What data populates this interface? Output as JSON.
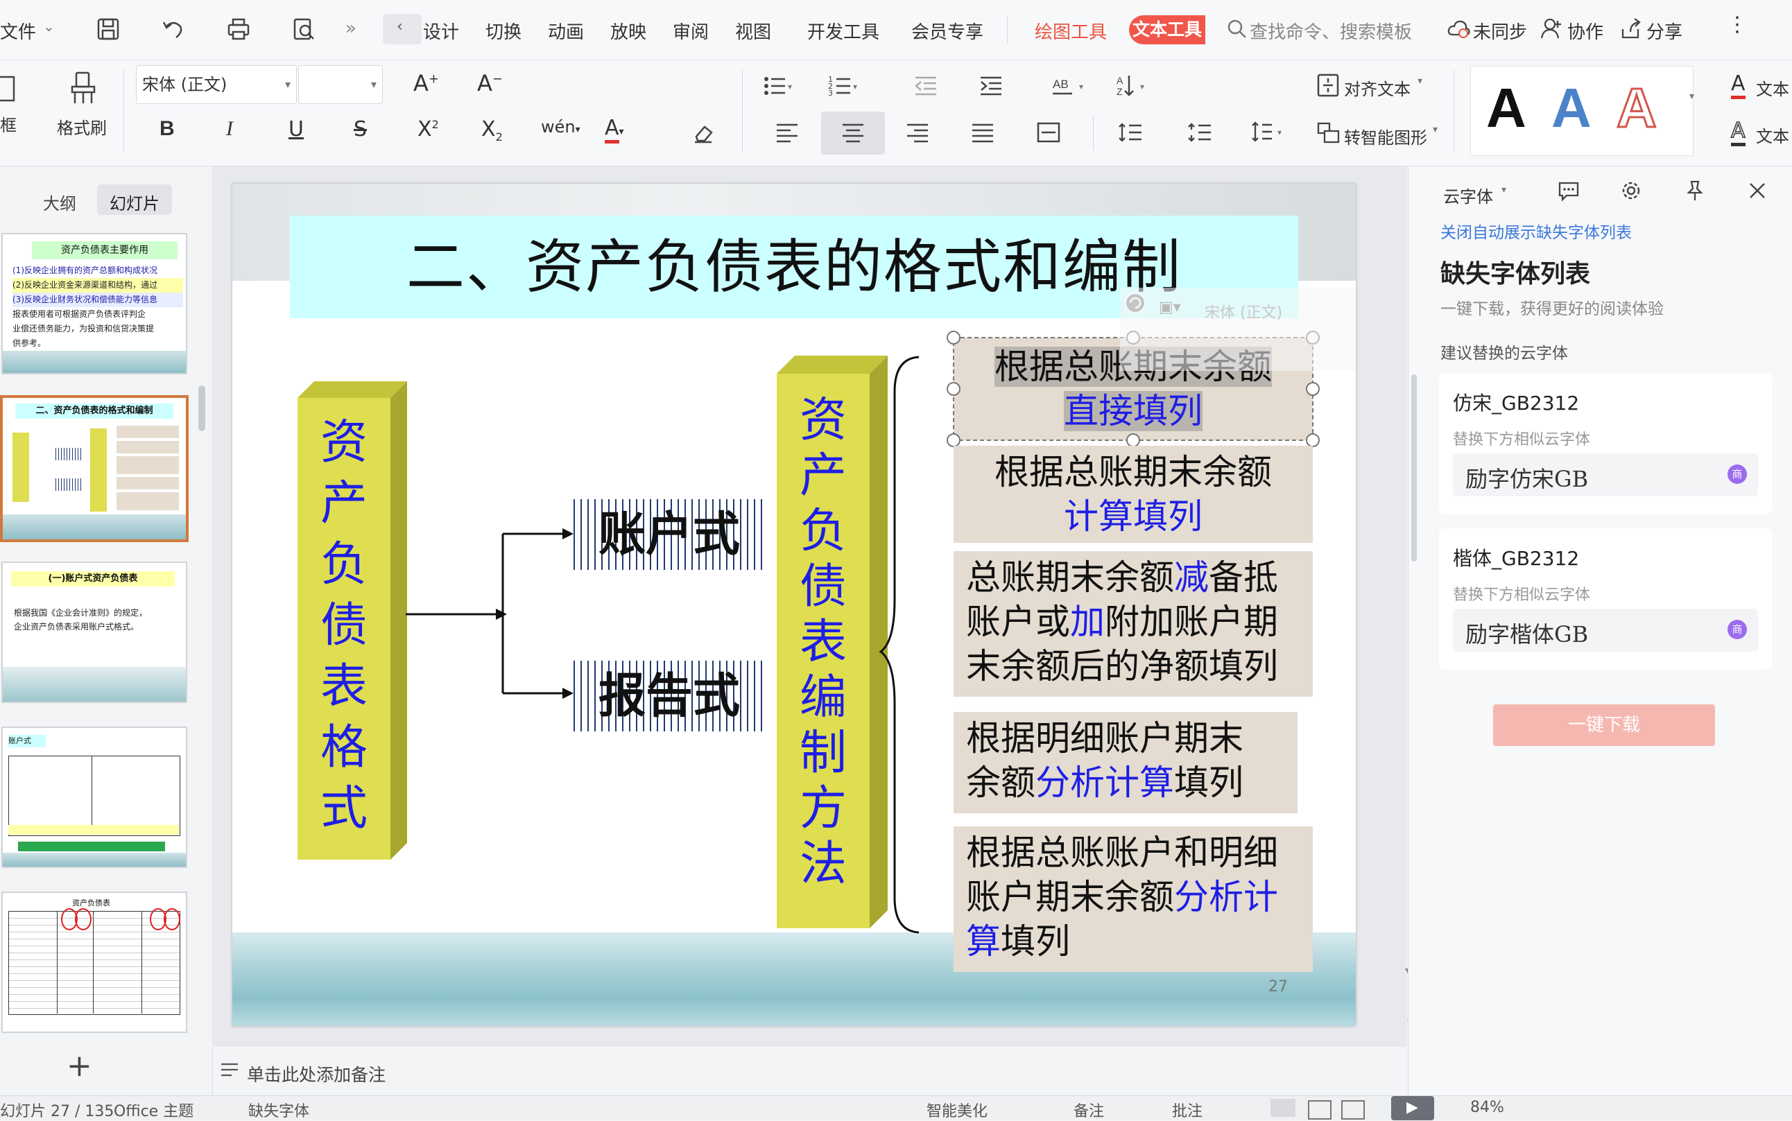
{
  "menubar": {
    "file": "文件",
    "tabs": [
      "设计",
      "切换",
      "动画",
      "放映",
      "审阅",
      "视图",
      "开发工具",
      "会员专享"
    ],
    "drawing_tools": "绘图工具",
    "text_tools": "文本工具",
    "search_placeholder": "查找命令、搜索模板",
    "sync": "未同步",
    "collab": "协作",
    "share": "分享"
  },
  "ribbon": {
    "textbox_label": "框",
    "format_painter": "格式刷",
    "font_name": "宋体 (正文)",
    "font_size": "",
    "align_text": "对齐文本",
    "smart_shape": "转智能图形",
    "text_fill": "文本",
    "text_outline": "文本",
    "style_letter": "A"
  },
  "leftpane": {
    "tab_outline": "大纲",
    "tab_slides": "幻灯片",
    "thumb1": {
      "title": "资产负债表主要作用",
      "lines": [
        "(1)反映企业拥有的资产总额和构成状况",
        "(2)反映企业资金来源渠道和结构，通过",
        "(3)反映企业财务状况和偿债能力等信息",
        "报表使用者可根据资产负债表评判企",
        "业偿还债务能力，为投资和信贷决策提",
        "供参考。"
      ]
    },
    "thumb2": {
      "title": "二、资产负债表的格式和编制"
    },
    "thumb3": {
      "title": "(一)账户式资产负债表",
      "lines": [
        "根据我国《企业会计准则》的规定，",
        "企业资产负债表采用账户式格式。"
      ]
    },
    "thumb4": {
      "title": "账户式"
    },
    "thumb5": {
      "title": "资产负债表"
    },
    "add": "+"
  },
  "slide": {
    "title": "二、资产负债表的格式和编制",
    "left_column": "资产负债表格式",
    "mid_column": "资产负债表编制方法",
    "account_form": "账户式",
    "report_form": "报告式",
    "page_number": "27",
    "methods": [
      {
        "line1": "根据总账期末余额",
        "line2": "直接填列"
      },
      {
        "line1": "根据总账期末余额",
        "line2": "计算填列"
      },
      {
        "a": "总账期末余额",
        "b": "减",
        "c": "备抵",
        "d": "账户或",
        "e": "加",
        "f": "附加账户期",
        "g": "末余额后的净额填列"
      },
      {
        "a": "根据明细账户期末",
        "b": "余额",
        "c": "分析计算",
        "d": "填列"
      },
      {
        "a": "根据总账账户和明细",
        "b": "账户期末余额",
        "c": "分析计",
        "d": "算",
        "e": "填列"
      }
    ],
    "mini_toolbar_font": "宋体 (正文)"
  },
  "rightpane": {
    "cloud_font": "云字体",
    "close_auto": "关闭自动展示缺失字体列表",
    "heading": "缺失字体列表",
    "subheading": "一键下载，获得更好的阅读体验",
    "suggest": "建议替换的云字体",
    "fonts": [
      {
        "name": "仿宋_GB2312",
        "hint": "替换下方相似云字体",
        "replacement": "励字仿宋GB",
        "badge": "商"
      },
      {
        "name": "楷体_GB2312",
        "hint": "替换下方相似云字体",
        "replacement": "励字楷体GB",
        "badge": "商"
      }
    ],
    "download": "一键下载"
  },
  "notes": {
    "placeholder": "单击此处添加备注"
  },
  "status": {
    "slide_count": "幻灯片 27 / 135",
    "theme": "Office 主题",
    "missing_font": "缺失字体",
    "beautify": "智能美化",
    "notes": "备注",
    "comment": "批注",
    "zoom": "84%"
  },
  "colors": {
    "accent_red": "#f0574a",
    "title_bg": "#ccffff",
    "pillar_yellow": "#dede50",
    "blue_text": "#1e1ee6"
  }
}
